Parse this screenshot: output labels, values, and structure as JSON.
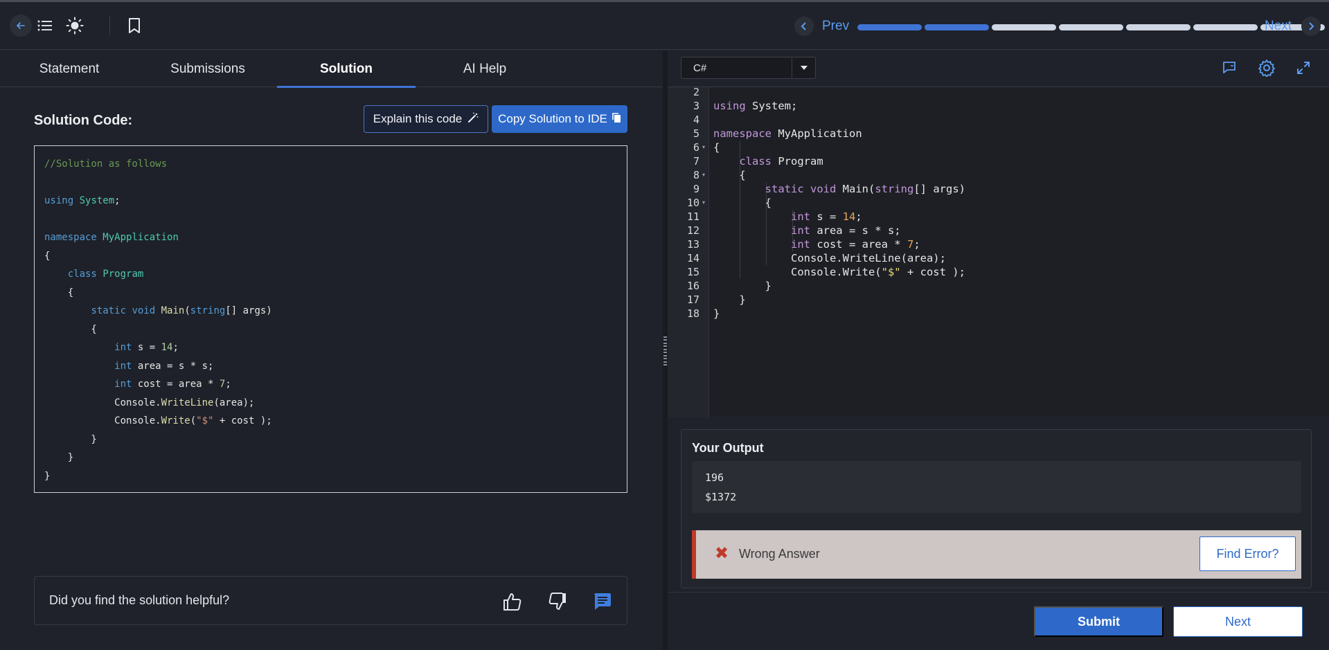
{
  "header": {
    "icons": [
      "back-arrow-icon",
      "list-icon",
      "sun-icon",
      "bookmark-icon"
    ],
    "prev_label": "Prev",
    "next_label": "Next",
    "progress": {
      "total_segments": 7,
      "completed_segments": 2
    },
    "colors": {
      "accent": "#3f74d6",
      "link": "#5b9cf0"
    }
  },
  "tabs": [
    {
      "label": "Statement",
      "active": false
    },
    {
      "label": "Submissions",
      "active": false
    },
    {
      "label": "Solution",
      "active": true
    },
    {
      "label": "AI Help",
      "active": false
    }
  ],
  "solution": {
    "title": "Solution Code:",
    "explain_button": "Explain this code",
    "copy_button": "Copy Solution to IDE",
    "code_lines": [
      "//Solution as follows",
      "",
      "using System;",
      "",
      "namespace MyApplication",
      "{",
      "    class Program",
      "    {",
      "        static void Main(string[] args)",
      "        {",
      "            int s = 14;",
      "            int area = s * s;",
      "            int cost = area * 7;",
      "            Console.WriteLine(area);",
      "            Console.Write(\"$\" + cost );",
      "        }",
      "    }",
      "}"
    ],
    "feedback_question": "Did you find the solution helpful?",
    "feedback_icons": [
      "thumbs-up-icon",
      "thumbs-down-icon",
      "comment-icon"
    ]
  },
  "editor": {
    "language": "C#",
    "toolbar_icons": [
      "chat-icon",
      "gear-icon",
      "expand-icon"
    ],
    "line_numbers": [
      "2",
      "3",
      "4",
      "5",
      "6",
      "7",
      "8",
      "9",
      "10",
      "11",
      "12",
      "13",
      "14",
      "15",
      "16",
      "17",
      "18"
    ],
    "lines": [
      "",
      "using System;",
      "",
      "namespace MyApplication",
      "{",
      "    class Program",
      "    {",
      "        static void Main(string[] args)",
      "        {",
      "            int s = 14;",
      "            int area = s * s;",
      "            int cost = area * 7;",
      "            Console.WriteLine(area);",
      "            Console.Write(\"$\" + cost );",
      "        }",
      "    }",
      "}"
    ]
  },
  "output": {
    "title": "Your Output",
    "lines": [
      "196",
      "$1372"
    ],
    "verdict": "Wrong Answer",
    "find_error_button": "Find Error?",
    "verdict_color": "#c0392b"
  },
  "actions": {
    "submit": "Submit",
    "next": "Next"
  }
}
